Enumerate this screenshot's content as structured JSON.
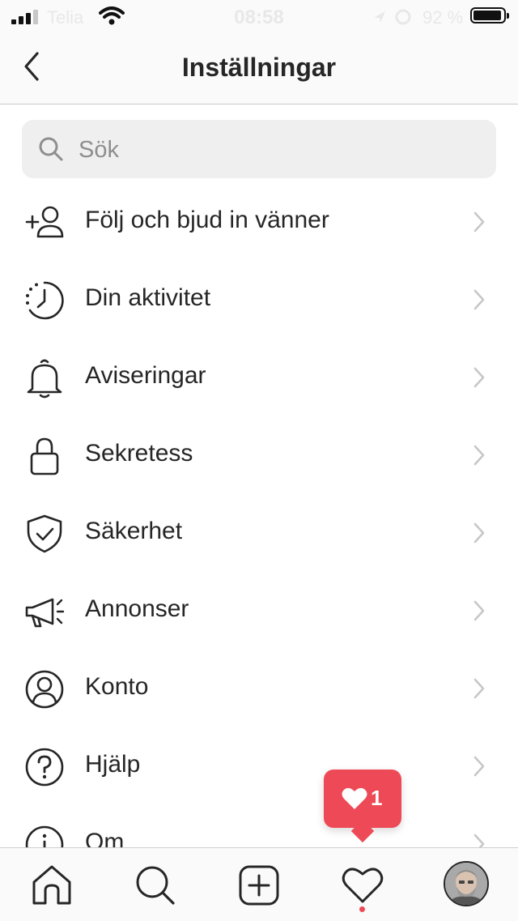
{
  "status_bar": {
    "carrier": "Telia",
    "time": "08:58",
    "battery_percent": "92 %"
  },
  "header": {
    "title": "Inställningar"
  },
  "search": {
    "placeholder": "Sök"
  },
  "menu": {
    "items": [
      {
        "label": "Följ och bjud in vänner",
        "icon": "add-person-icon"
      },
      {
        "label": "Din aktivitet",
        "icon": "activity-clock-icon"
      },
      {
        "label": "Aviseringar",
        "icon": "bell-icon"
      },
      {
        "label": "Sekretess",
        "icon": "lock-icon"
      },
      {
        "label": "Säkerhet",
        "icon": "shield-check-icon"
      },
      {
        "label": "Annonser",
        "icon": "megaphone-icon"
      },
      {
        "label": "Konto",
        "icon": "account-circle-icon"
      },
      {
        "label": "Hjälp",
        "icon": "help-circle-icon"
      },
      {
        "label": "Om",
        "icon": "info-circle-icon"
      }
    ]
  },
  "notification": {
    "count": "1"
  },
  "tab_bar": {
    "tabs": [
      "home-icon",
      "search-icon",
      "add-post-icon",
      "activity-heart-icon",
      "profile-avatar"
    ]
  },
  "colors": {
    "accent_red": "#ed4956",
    "text": "#262626",
    "muted": "#8e8e8e",
    "search_bg": "#efefef"
  }
}
